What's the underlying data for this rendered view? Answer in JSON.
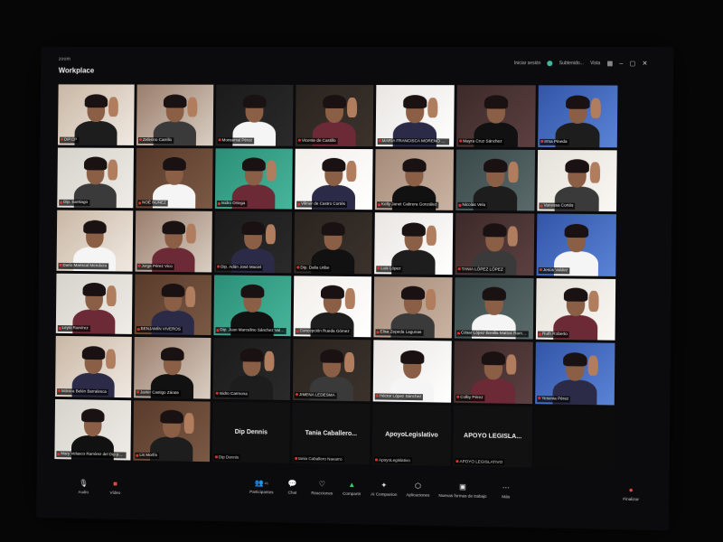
{
  "window": {
    "brand_sup": "zoom",
    "brand_name": "Workplace",
    "status_text": "Iniciar sesión",
    "recording_text": "Subtenido...",
    "view_text": "Vista"
  },
  "participants": [
    {
      "label": "DIP.CP"
    },
    {
      "label": "Zeferino Carrillo"
    },
    {
      "label": "Monserrat Pérez"
    },
    {
      "label": "Vicente de Castillo"
    },
    {
      "label": "MARÍA FRANCISCA MORENO SANTIAGO"
    },
    {
      "label": "Mayra Cruz Sánchez"
    },
    {
      "label": "Irma Pineda"
    },
    {
      "label": "Dip. Santiago"
    },
    {
      "label": "NOÉ NÚÑEZ"
    },
    {
      "label": "Isidro Ortega"
    },
    {
      "label": "Vilmer de Castro Cortés"
    },
    {
      "label": "Kelly Janet Cabrera González"
    },
    {
      "label": "Nicolás Vela"
    },
    {
      "label": "Vanessa Cortés"
    },
    {
      "label": "Darío Mariscal Mendoza"
    },
    {
      "label": "Jorge Pérez Vico"
    },
    {
      "label": "Dip. Adán José Maciel"
    },
    {
      "label": "Dip. Dalia Uribe"
    },
    {
      "label": "Luis López"
    },
    {
      "label": "TANIA LÓPEZ LÓPEZ"
    },
    {
      "label": "Jesús Valdez"
    },
    {
      "label": "Leyni Ramírez"
    },
    {
      "label": "BENJAMÍN VIVEROS"
    },
    {
      "label": "Dip. Juan Marcelino Sánchez Valdovinos"
    },
    {
      "label": "Concepción Rueda Gómez"
    },
    {
      "label": "Elisa Zepeda Lagunas"
    },
    {
      "label": "César López Bonilla Mattos Ramírez Arv..."
    },
    {
      "label": "Ruth Roberto"
    },
    {
      "label": "Mónica Belén Barralesca"
    },
    {
      "label": "Javier Castigo Zárate"
    },
    {
      "label": "Isidro Carmona"
    },
    {
      "label": "JIMENA LEDESMA"
    },
    {
      "label": "Héctor López Sánchez"
    },
    {
      "label": "Colby Pérez"
    },
    {
      "label": "Yesenia Pérez"
    },
    {
      "label": "Mary Velasco Ramírez del Dip poleota"
    },
    {
      "label": "Lis Morfín"
    }
  ],
  "name_tiles": [
    {
      "big": "Dip Dennis",
      "label": "Dip Dennis"
    },
    {
      "big": "Tania Caballero...",
      "label": "tania Caballero Navarro"
    },
    {
      "big": "ApoyoLegislativo",
      "label": "ApoyoLegislativo"
    },
    {
      "big": "APOYO LEGISLA...",
      "label": "APOYO LEGISLATIVO"
    }
  ],
  "toolbar": {
    "audio": "Audio",
    "video": "Vídeo",
    "participants": "Participantes",
    "participants_count": "41",
    "chat": "Chat",
    "reactions": "Reacciones",
    "share": "Compartir",
    "ai": "AI Companion",
    "apps": "Aplicaciones",
    "whiteboard": "Nuevas formas de trabajo",
    "more": "Más",
    "end": "Finalizar"
  },
  "colors": {
    "accent_red": "#d8352f",
    "status_green": "#3fb9a0"
  }
}
